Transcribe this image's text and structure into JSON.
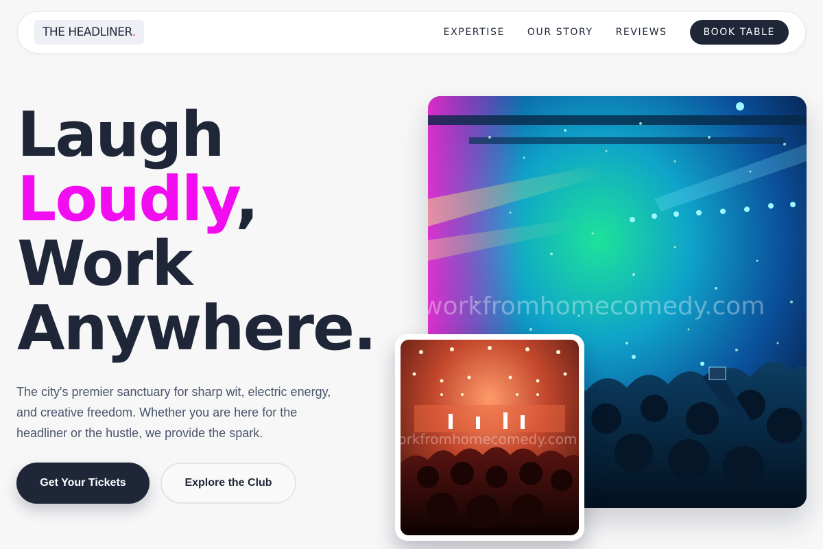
{
  "nav": {
    "logo_text": "THE HEADLINER",
    "logo_dot": ".",
    "links": [
      {
        "label": "EXPERTISE"
      },
      {
        "label": "OUR STORY"
      },
      {
        "label": "REVIEWS"
      }
    ],
    "cta_label": "BOOK TABLE"
  },
  "hero": {
    "line1": "Laugh",
    "line2_accent": "Loudly",
    "line2_comma": ",",
    "line3": "Work",
    "line4": "Anywhere.",
    "lead": "The city's premier sanctuary for sharp wit, electric energy, and creative freedom. Whether you are here for the headliner or the hustle, we provide the spark.",
    "primary_button": "Get Your Tickets",
    "secondary_button": "Explore the Club"
  },
  "images": {
    "main_watermark": "workfromhomecomedy.com",
    "small_watermark": "workfromhomecomedy.com"
  },
  "colors": {
    "accent": "#f20cf0",
    "dark": "#1e2638",
    "logo_dot": "#ff1f8f"
  }
}
